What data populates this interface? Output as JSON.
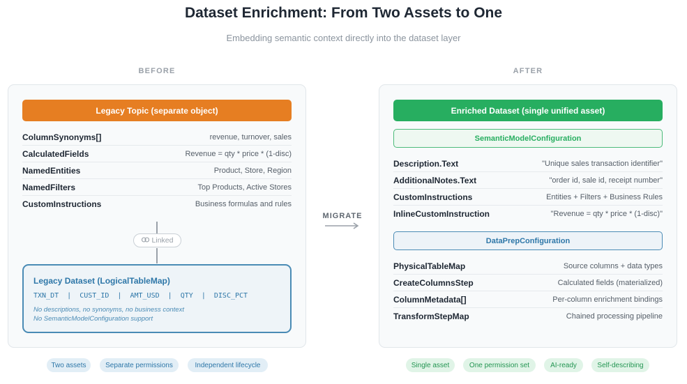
{
  "title": "Dataset Enrichment: From Two Assets to One",
  "subtitle": "Embedding semantic context directly into the dataset layer",
  "before": {
    "label": "BEFORE",
    "header": "Legacy Topic (separate object)",
    "rows": [
      {
        "key": "ColumnSynonyms[]",
        "value": "revenue, turnover, sales"
      },
      {
        "key": "CalculatedFields",
        "value": "Revenue = qty * price * (1-disc)"
      },
      {
        "key": "NamedEntities",
        "value": "Product, Store, Region"
      },
      {
        "key": "NamedFilters",
        "value": "Top Products, Active Stores"
      },
      {
        "key": "CustomInstructions",
        "value": "Business formulas and rules"
      }
    ],
    "linked_label": "Linked",
    "legacy_dataset": {
      "title": "Legacy Dataset (LogicalTableMap)",
      "columns": "TXN_DT  |  CUST_ID  |  AMT_USD  |  QTY  |  DISC_PCT",
      "note_1": "No descriptions, no synonyms, no business context",
      "note_2": "No SemanticModelConfiguration support"
    },
    "tags": [
      "Two assets",
      "Separate permissions",
      "Independent lifecycle"
    ]
  },
  "migrate_label": "MIGRATE",
  "after": {
    "label": "AFTER",
    "header": "Enriched Dataset (single unified asset)",
    "semantic_config": "SemanticModelConfiguration",
    "semantic_rows": [
      {
        "key": "Description.Text",
        "value": "\"Unique sales transaction identifier\""
      },
      {
        "key": "AdditionalNotes.Text",
        "value": "\"order id, sale id, receipt number\""
      },
      {
        "key": "CustomInstructions",
        "value": "Entities + Filters + Business Rules"
      },
      {
        "key": "InlineCustomInstruction",
        "value": "\"Revenue = qty * price * (1-disc)\""
      }
    ],
    "dataprep_config": "DataPrepConfiguration",
    "dataprep_rows": [
      {
        "key": "PhysicalTableMap",
        "value": "Source columns + data types"
      },
      {
        "key": "CreateColumnsStep",
        "value": "Calculated fields (materialized)"
      },
      {
        "key": "ColumnMetadata[]",
        "value": "Per-column enrichment bindings"
      },
      {
        "key": "TransformStepMap",
        "value": "Chained processing pipeline"
      }
    ],
    "tags": [
      "Single asset",
      "One permission set",
      "AI-ready",
      "Self-describing"
    ]
  },
  "colors": {
    "orange": "#e67e22",
    "green": "#27ae60",
    "blue": "#2e77a8"
  }
}
